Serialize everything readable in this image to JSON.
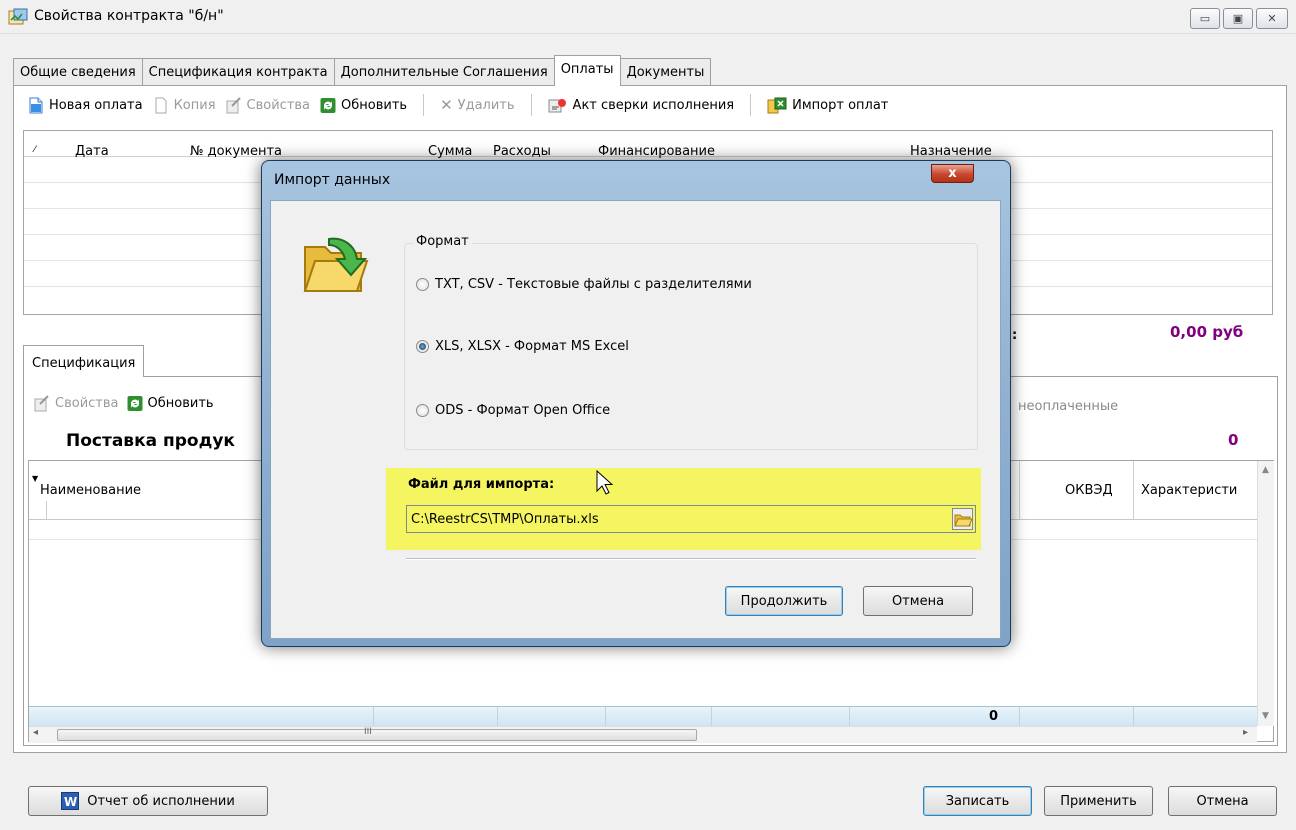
{
  "window": {
    "title": "Свойства контракта \"б/н\""
  },
  "tabs": [
    "Общие сведения",
    "Спецификация контракта",
    "Дополнительные Соглашения",
    "Оплаты",
    "Документы"
  ],
  "toolbar": {
    "new": "Новая оплата",
    "copy": "Копия",
    "props": "Свойства",
    "refresh": "Обновить",
    "delete": "Удалить",
    "act": "Акт сверки исполнения",
    "import": "Импорт оплат"
  },
  "grid1": {
    "columns": [
      "Дата",
      "№ документа",
      "Сумма",
      "Расходы",
      "Финансирование",
      "Назначение"
    ],
    "total": "0,00 руб",
    "colon": ":"
  },
  "spec": {
    "tab": "Спецификация",
    "props": "Свойства",
    "refresh": "Обновить",
    "unpaid": "неоплаченные",
    "title": "Поставка продук",
    "count": "0",
    "col_name": "Наименование",
    "col_okved": "ОКВЭД",
    "col_char": "Характеристи",
    "footer_total": "0",
    "scroll_mark": "III"
  },
  "bottom": {
    "report": "Отчет об исполнении",
    "save": "Записать",
    "apply": "Применить",
    "cancel": "Отмена"
  },
  "dialog": {
    "title": "Импорт данных",
    "close": "x",
    "format_label": "Формат",
    "options": [
      "TXT, CSV -  Текстовые файлы с разделителями",
      "XLS, XLSX - Формат MS Excel",
      "ODS - Формат Open Office"
    ],
    "selected": 1,
    "file_label": "Файл для импорта:",
    "file_path": "C:\\ReestrCS\\TMP\\Оплаты.xls",
    "continue": "Продолжить",
    "cancel": "Отмена"
  },
  "colors": {
    "accent_purple": "#800080",
    "highlight": "#f5f561"
  }
}
